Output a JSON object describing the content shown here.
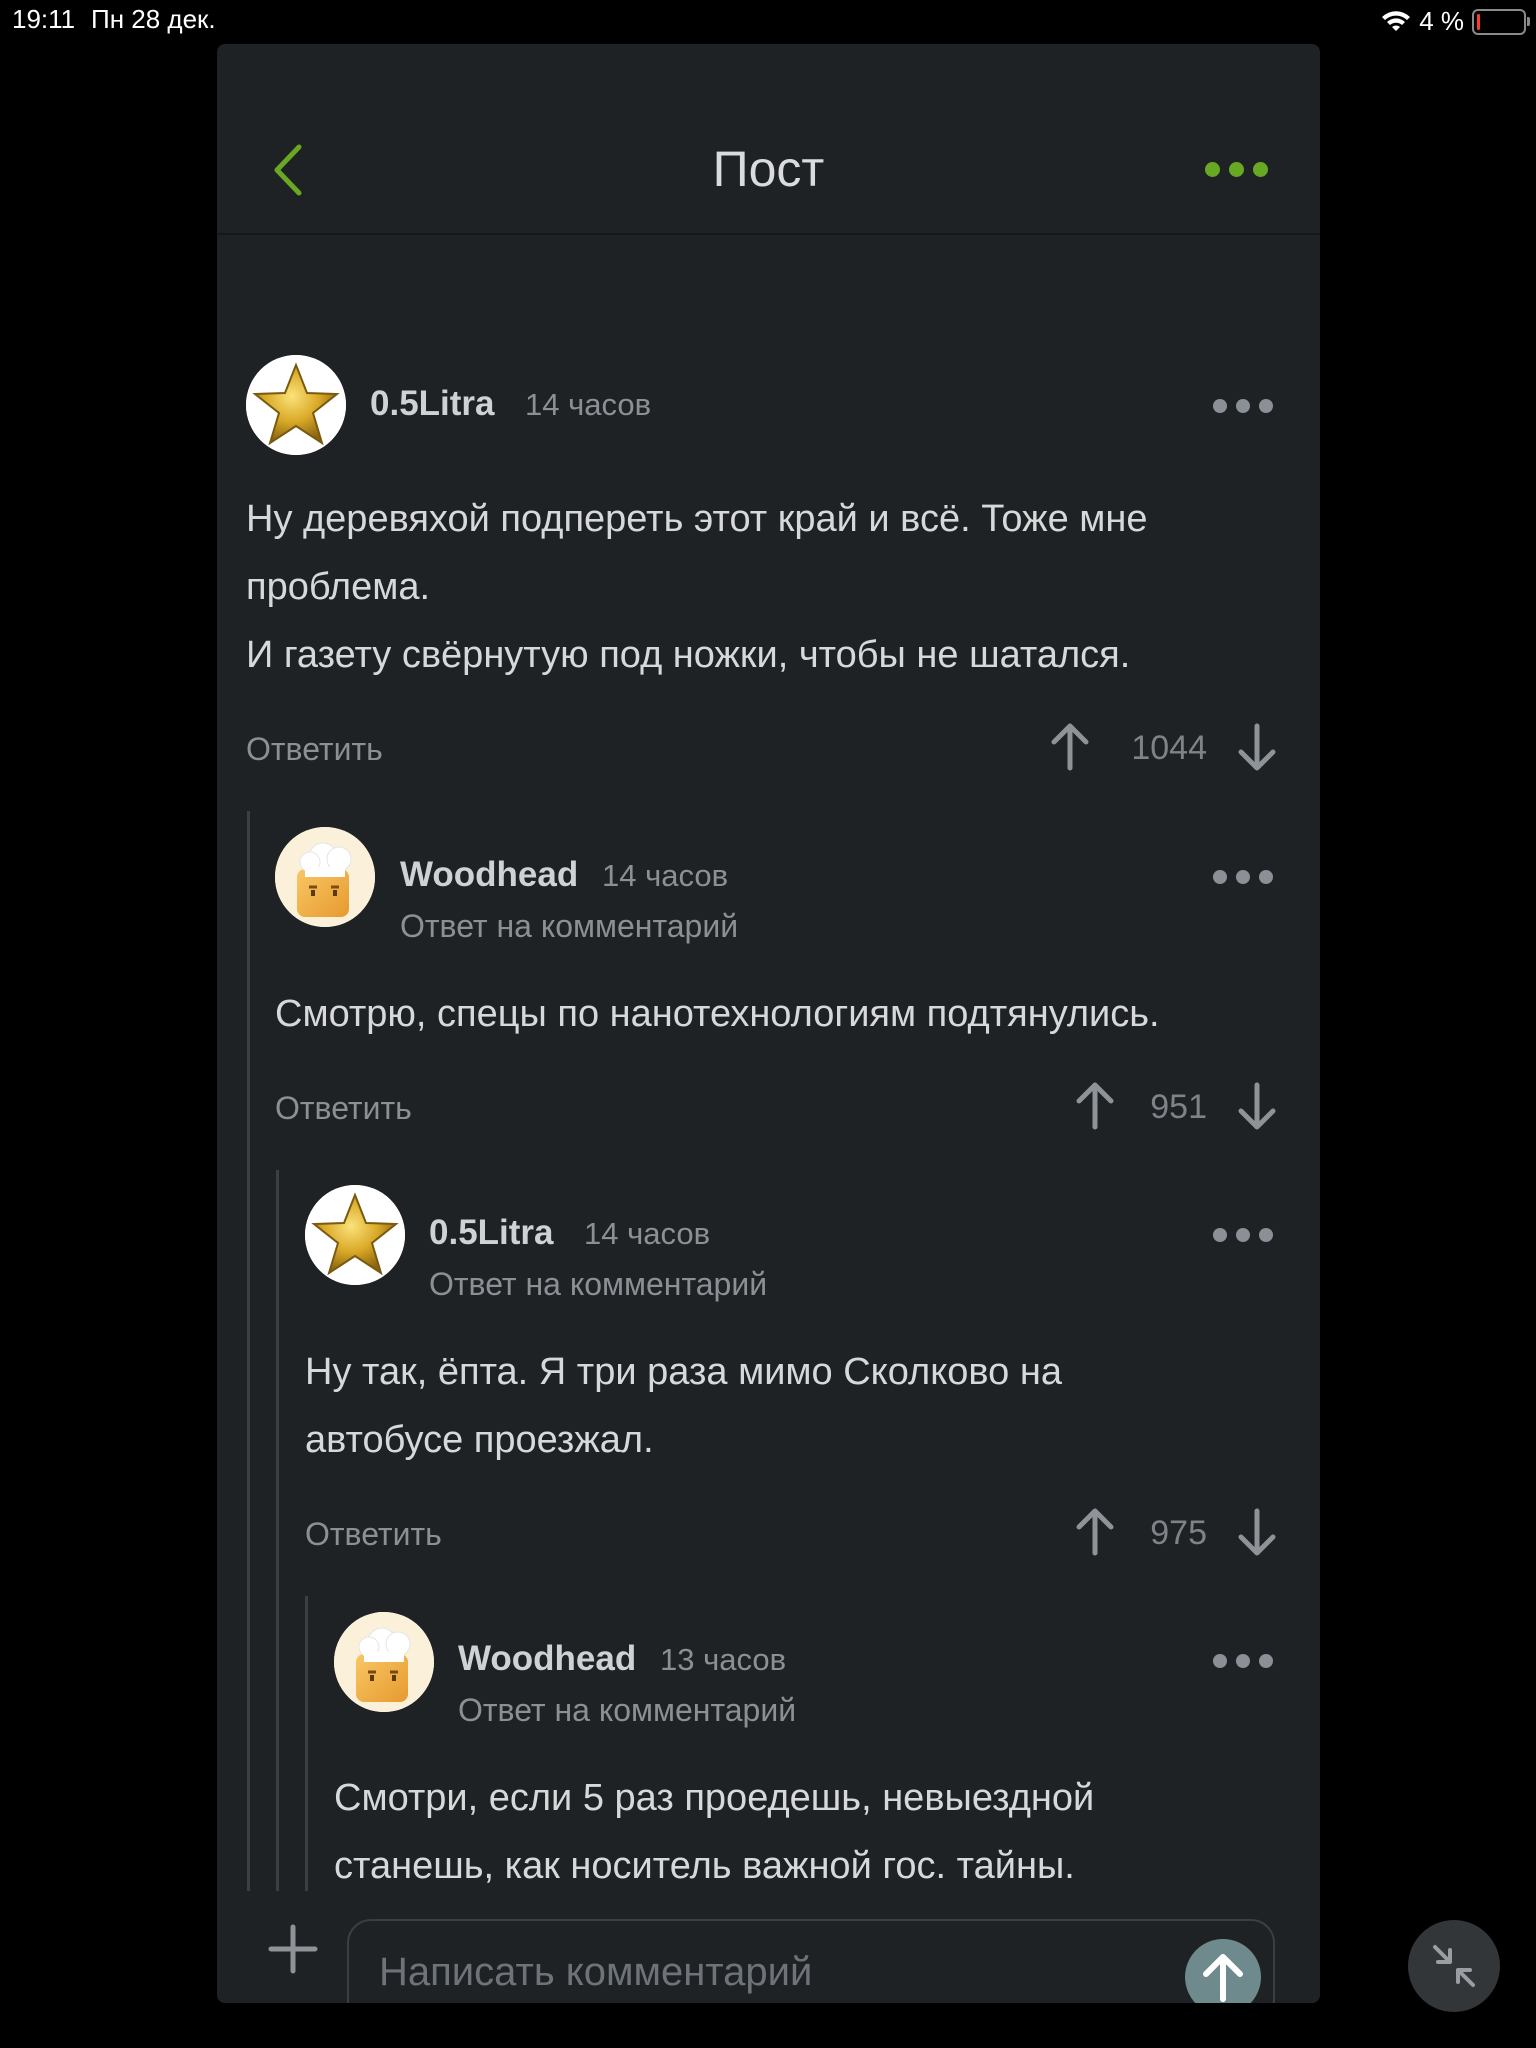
{
  "status_bar": {
    "time": "19:11",
    "date": "Пн 28 дек.",
    "battery": "4 %",
    "battery_level": 0.04
  },
  "header": {
    "title": "Пост"
  },
  "comments": [
    {
      "author": "0.5Litra",
      "time": "14 часов",
      "subtitle": "",
      "text_lines": [
        "Ну деревяхой подпереть этот край и всё. Тоже мне",
        "проблема.",
        "И газету свёрнутую под ножки, чтобы не шатался."
      ],
      "reply": "Ответить",
      "score": "1044",
      "avatar": "star-avatar"
    },
    {
      "author": "Woodhead",
      "time": "14 часов",
      "subtitle": "Ответ на комментарий",
      "text_lines": [
        "Смотрю, спецы по нанотехнологиям подтянулись."
      ],
      "reply": "Ответить",
      "score": "951",
      "avatar": "chef-avatar"
    },
    {
      "author": "0.5Litra",
      "time": "14 часов",
      "subtitle": "Ответ на комментарий",
      "text_lines": [
        "Ну так, ёпта. Я три раза мимо Сколково на",
        "автобусе проезжал."
      ],
      "reply": "Ответить",
      "score": "975",
      "avatar": "star-avatar"
    },
    {
      "author": "Woodhead",
      "time": "13 часов",
      "subtitle": "Ответ на комментарий",
      "text_lines": [
        "Смотри, если 5 раз проедешь, невыездной",
        "станешь, как носитель важной гос. тайны."
      ],
      "avatar": "chef-avatar"
    }
  ],
  "footer": {
    "placeholder": "Написать комментарий"
  },
  "colors": {
    "accent": "#68a823",
    "panel": "#1f2225",
    "background": "#000000"
  }
}
